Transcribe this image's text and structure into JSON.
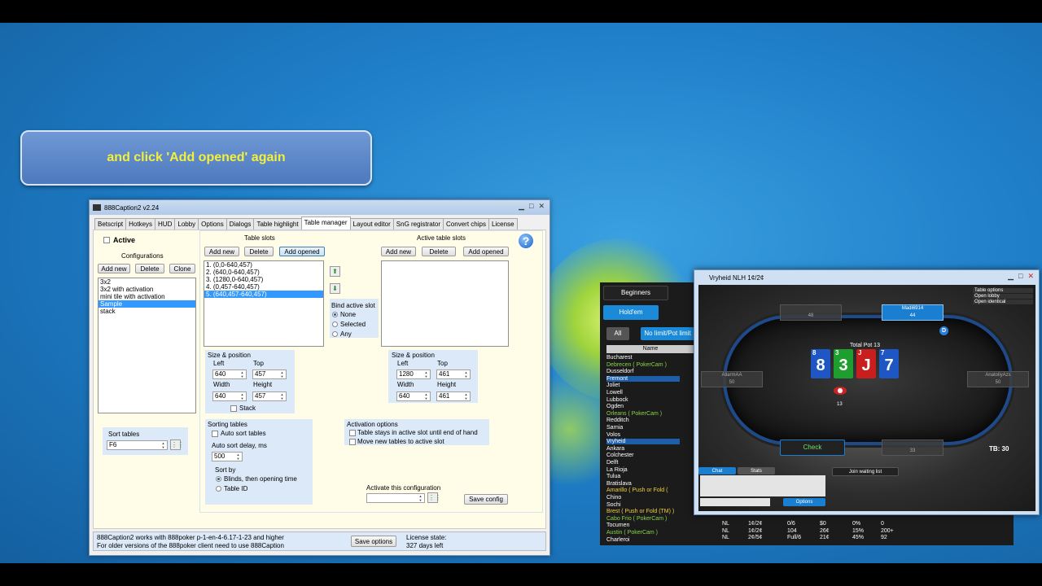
{
  "callout": {
    "text": "and click 'Add opened' again"
  },
  "caption_window": {
    "title": "888Caption2 v2.24",
    "tabs": [
      "Betscript",
      "Hotkeys",
      "HUD",
      "Lobby",
      "Options",
      "Dialogs",
      "Table highlight",
      "Table manager",
      "Layout editor",
      "SnG registrator",
      "Convert chips",
      "License"
    ],
    "active_tab": "Table manager",
    "active_label": "Active",
    "configurations_label": "Configurations",
    "config_buttons": {
      "add": "Add new",
      "delete": "Delete",
      "clone": "Clone"
    },
    "configurations": [
      "3x2",
      "3x2 with activation",
      "mini tile with activation",
      "Sample",
      "stack"
    ],
    "selected_configuration": "Sample",
    "table_slots": {
      "header": "Table slots",
      "buttons": {
        "add": "Add new",
        "delete": "Delete",
        "add_opened": "Add opened"
      },
      "items": [
        "1. (0,0-640,457)",
        "2. (640,0-640,457)",
        "3. (1280,0-640,457)",
        "4. (0,457-640,457)",
        "5. (640,457-640,457)"
      ],
      "selected": "5. (640,457-640,457)"
    },
    "bind_active_slot": {
      "label": "Bind active slot",
      "options": [
        "None",
        "Selected",
        "Any"
      ],
      "selected": "None"
    },
    "active_table_slots": {
      "header": "Active table slots",
      "buttons": {
        "add": "Add new",
        "delete": "Delete",
        "add_opened": "Add opened"
      }
    },
    "size_position_left": {
      "label": "Size & position",
      "left_label": "Left",
      "top_label": "Top",
      "width_label": "Width",
      "height_label": "Height",
      "left": "640",
      "top": "457",
      "width": "640",
      "height": "457",
      "stack_label": "Stack"
    },
    "size_position_right": {
      "label": "Size & position",
      "left_label": "Left",
      "top_label": "Top",
      "width_label": "Width",
      "height_label": "Height",
      "left": "1280",
      "top": "461",
      "width": "640",
      "height": "461"
    },
    "sorting": {
      "label": "Sorting tables",
      "auto_sort_label": "Auto sort tables",
      "delay_label": "Auto sort delay, ms",
      "delay": "500",
      "sort_by_label": "Sort by",
      "options": [
        "Blinds, then opening time",
        "Table ID"
      ],
      "selected": "Blinds, then opening time"
    },
    "activation": {
      "label": "Activation options",
      "options": [
        "Table stays in active slot until end of hand",
        "Move new tables to active slot"
      ]
    },
    "activate_config_label": "Activate this configuration",
    "save_config": "Save config",
    "sort_tables": {
      "label": "Sort tables",
      "value": "F6"
    },
    "status": {
      "line1": "888Caption2 works with 888poker p-1-en-4-6.17-1-23 and higher",
      "line2": "For older versions of the 888poker client need to use 888Caption",
      "save_options": "Save options",
      "license_label": "License state:",
      "license_value": "327 days left"
    }
  },
  "lobby": {
    "tabs": [
      "Beginners",
      "Hold'em",
      "All",
      "No limit/Pot limit"
    ],
    "name_header": "Name",
    "rows": [
      "Bucharest",
      "Debrecen ( PokerCam )",
      "Dusseldorf",
      "Fremont",
      "Joliet",
      "Lowell",
      "Lubbock",
      "Ogden",
      "Orleans ( PokerCam )",
      "Redditch",
      "Sarnia",
      "Volos",
      "Vryheid",
      "Ankara",
      "Colchester",
      "Delft",
      "La Rioja",
      "Tulua",
      "Bratislava",
      "Amarillo ( Push or Fold (",
      "Chino",
      "Sochi",
      "Brest ( Push or Fold (TM) )",
      "Cabo Frio ( PokerCam )",
      "Tocumen",
      "Austin ( PokerCam )",
      "Charleroi"
    ],
    "bottom_rows": [
      {
        "type": "NL",
        "stakes": "1¢/2¢",
        "seats": "0/6",
        "pot": "$0",
        "flop": "0%",
        "hands": "0"
      },
      {
        "type": "NL",
        "stakes": "1¢/2¢",
        "seats": "104",
        "pot": "26¢",
        "flop": "15%",
        "hands": "200+"
      },
      {
        "type": "NL",
        "stakes": "2¢/5¢",
        "seats": "Full/6",
        "pot": "21¢",
        "flop": "45%",
        "hands": "92"
      }
    ]
  },
  "poker_window": {
    "title": "Vryheid NLH 1¢/2¢",
    "menu": [
      "Table options",
      "Open lobby",
      "Open identical"
    ],
    "seats": [
      {
        "name": "Madi6914",
        "stack": "44"
      },
      {
        "name": "",
        "stack": "48"
      },
      {
        "name": "AllarmAA",
        "stack": "50"
      },
      {
        "name": "AnatoliyAzs",
        "stack": "50"
      },
      {
        "name": "",
        "stack": "33"
      }
    ],
    "pot_label": "Total Pot 13",
    "bet": "13",
    "cards": [
      {
        "rank": "8",
        "color": "#1e56c4"
      },
      {
        "rank": "3",
        "color": "#1e9e2e"
      },
      {
        "rank": "J",
        "color": "#c81e1e"
      },
      {
        "rank": "7",
        "color": "#1e56c4"
      }
    ],
    "dealer": "D",
    "check_label": "Check",
    "tb_label": "TB: 30",
    "chat_tab": "Chat",
    "stats_tab": "Stats",
    "join_waiting": "Join waiting list",
    "options_btn": "Options"
  }
}
